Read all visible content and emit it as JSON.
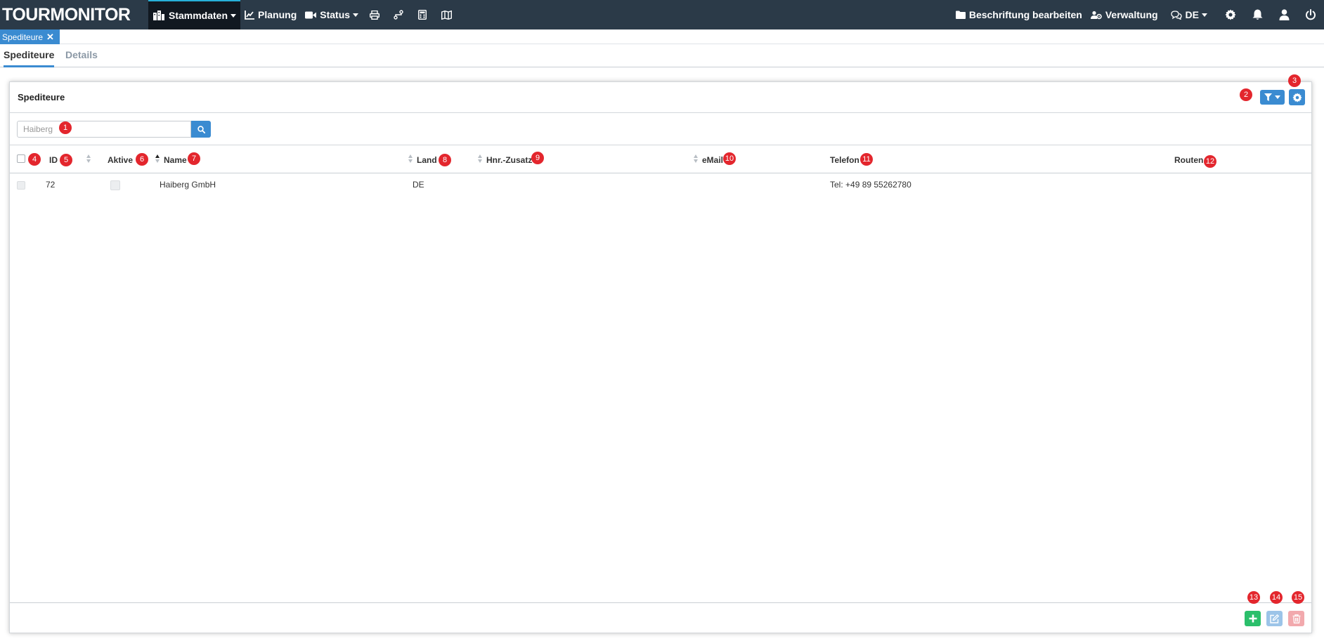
{
  "app": {
    "logo": "TOURMONITOR"
  },
  "nav": {
    "stammdaten": "Stammdaten",
    "planung": "Planung",
    "status": "Status",
    "beschriftung": "Beschriftung bearbeiten",
    "verwaltung": "Verwaltung",
    "language": "DE"
  },
  "open_tab": {
    "label": "Spediteure"
  },
  "subtabs": {
    "active": "Spediteure",
    "inactive": "Details"
  },
  "panel": {
    "title": "Spediteure"
  },
  "search": {
    "value": "Haiberg"
  },
  "table": {
    "headers": {
      "id": "ID",
      "aktive": "Aktive",
      "name": "Name",
      "land": "Land",
      "hnr": "Hnr.-Zusatz",
      "email": "eMail",
      "telefon": "Telefon",
      "routen": "Routen"
    },
    "rows": [
      {
        "id": "72",
        "name": "Haiberg GmbH",
        "land": "DE",
        "hnr": "",
        "email": "",
        "telefon": "Tel: +49 89 55262780",
        "routen": ""
      }
    ]
  },
  "badges": [
    "1",
    "2",
    "3",
    "4",
    "5",
    "6",
    "7",
    "8",
    "9",
    "10",
    "11",
    "12",
    "13",
    "14",
    "15"
  ],
  "colors": {
    "topbar": "#2b3a48",
    "accent": "#3a8bd1",
    "badge": "#e3262d",
    "add": "#2bbf6b",
    "edit": "#9cc4e8",
    "delete": "#f2a9ad"
  }
}
